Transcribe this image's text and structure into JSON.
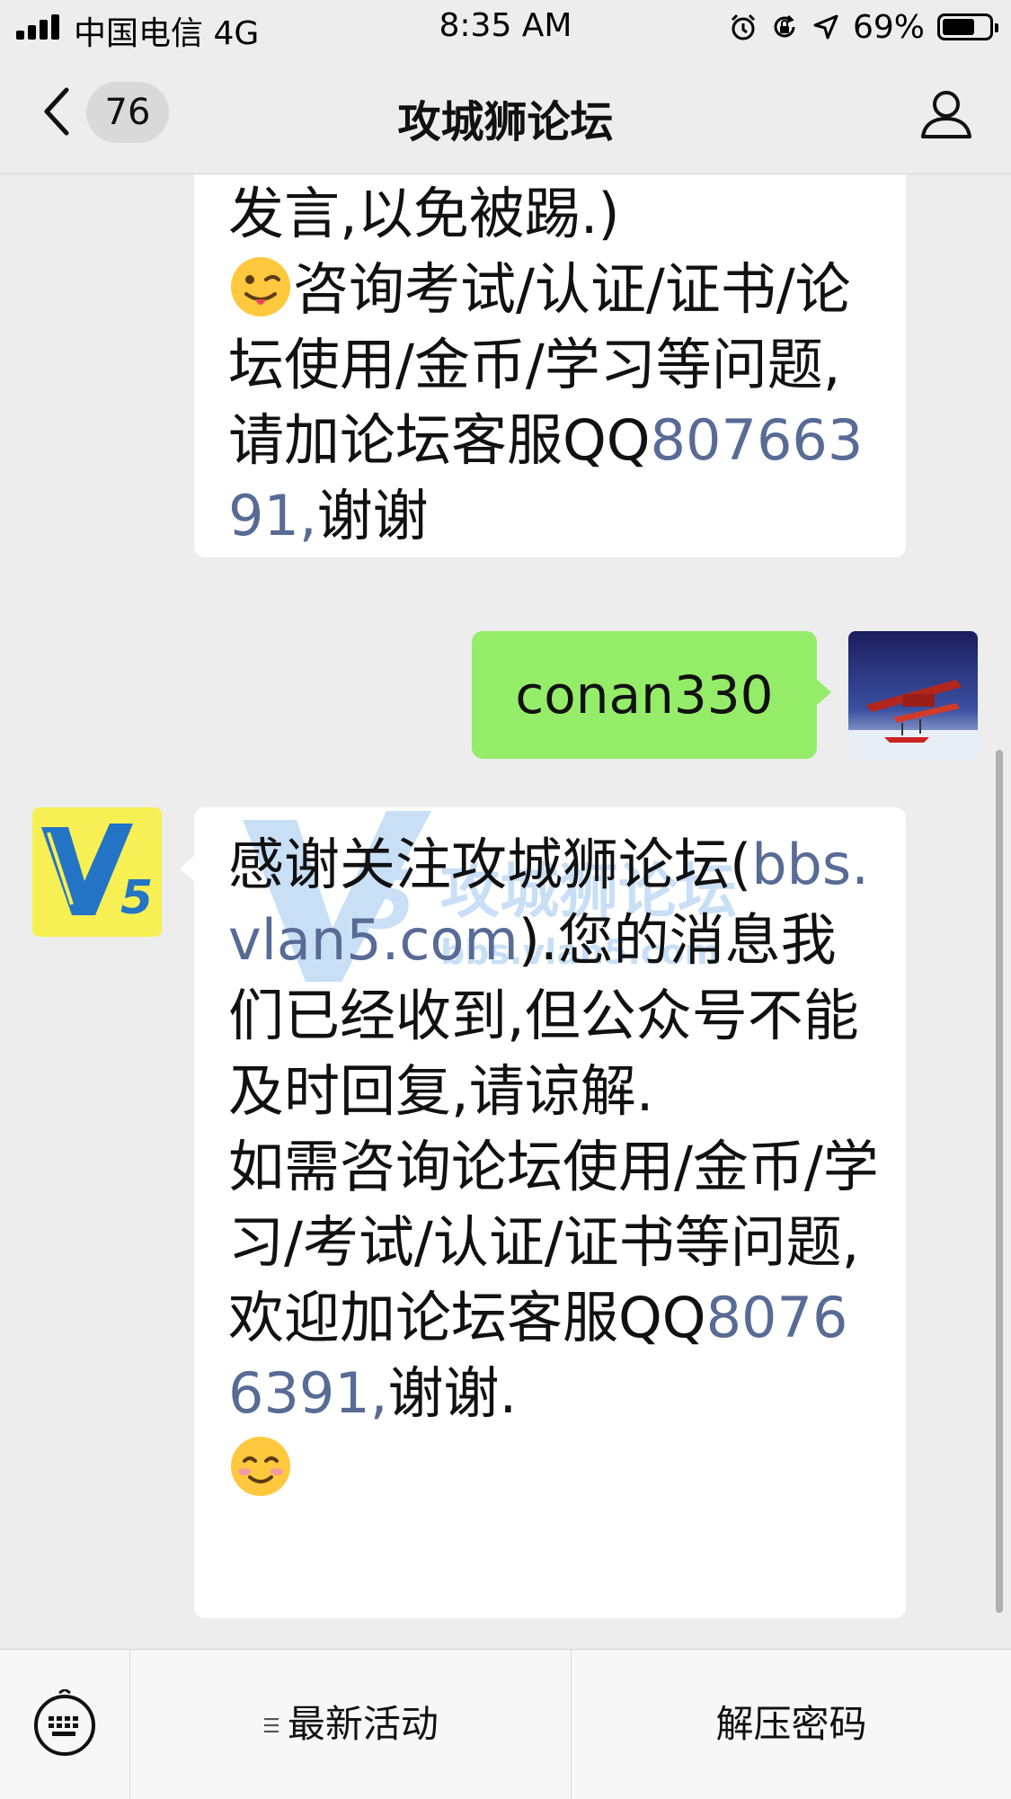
{
  "status_bar": {
    "carrier": "中国电信 4G",
    "time": "8:35 AM",
    "battery_percent": "69%",
    "battery_level": 0.69,
    "icons": [
      "signal-icon",
      "alarm-icon",
      "rotation-lock-icon",
      "location-icon",
      "battery-icon"
    ]
  },
  "nav": {
    "back_icon": "chevron-left-icon",
    "unread_count": "76",
    "title": "攻城狮论坛",
    "profile_icon": "person-icon"
  },
  "messages": [
    {
      "sender": "official-account",
      "lines": [
        "发言,以免被踢.)"
      ],
      "emoji": "winking-tongue-emoji",
      "text_after_emoji": "咨询考试/认证/证书/论坛使用/金币/学习等问题,请加论坛客服QQ",
      "qq_link": "80766391,",
      "tail": "谢谢"
    },
    {
      "sender": "me",
      "text": "conan330",
      "avatar": "seaplane-avatar"
    },
    {
      "sender": "official-account",
      "avatar": "v5-logo-avatar",
      "watermark_text": "攻城狮论坛",
      "watermark_url": "bbs.vlan5.com",
      "text_intro": "感谢关注攻城狮论坛(",
      "site_link": "bbs.vlan5.com",
      "text_after_link": ").您的消息我们已经收到,但公众号不能及时回复,请谅解.",
      "text_help": "如需咨询论坛使用/金币/学习/考试/认证/证书等问题,欢迎加论坛客服QQ",
      "qq_link": "80766391,",
      "tail": "谢谢.",
      "emoji": "smiling-blush-emoji"
    }
  ],
  "bottom_menu": {
    "keyboard_icon": "keyboard-icon",
    "items": [
      {
        "label": "最新活动",
        "icon": "submenu-icon"
      },
      {
        "label": "解压密码"
      }
    ]
  }
}
